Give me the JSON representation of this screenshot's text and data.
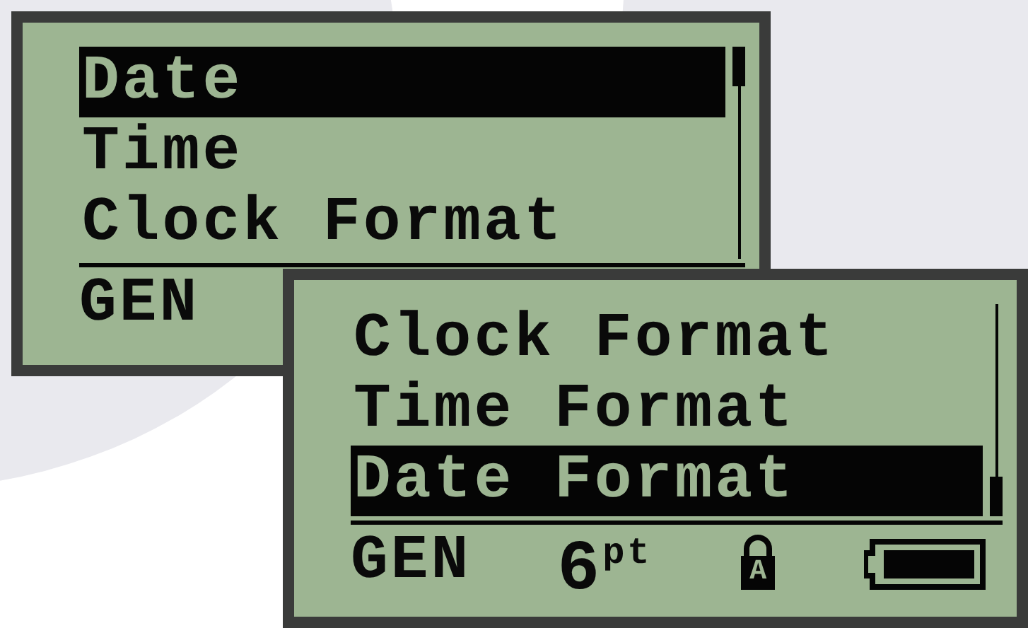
{
  "screens": [
    {
      "items": [
        {
          "label": "Date",
          "selected": true
        },
        {
          "label": "Time",
          "selected": false
        },
        {
          "label": "Clock Format",
          "selected": false
        }
      ],
      "status": [
        {
          "kind": "mode",
          "text": "GEN"
        }
      ]
    },
    {
      "items": [
        {
          "label": "Clock Format",
          "selected": false
        },
        {
          "label": "Time Format",
          "selected": false
        },
        {
          "label": "Date Format",
          "selected": true
        }
      ],
      "status": [
        {
          "kind": "mode",
          "text": "GEN"
        },
        {
          "kind": "size",
          "text": "6$^{pt}$"
        },
        {
          "kind": "lock",
          "text": "A"
        },
        {
          "kind": "battery"
        }
      ]
    }
  ]
}
